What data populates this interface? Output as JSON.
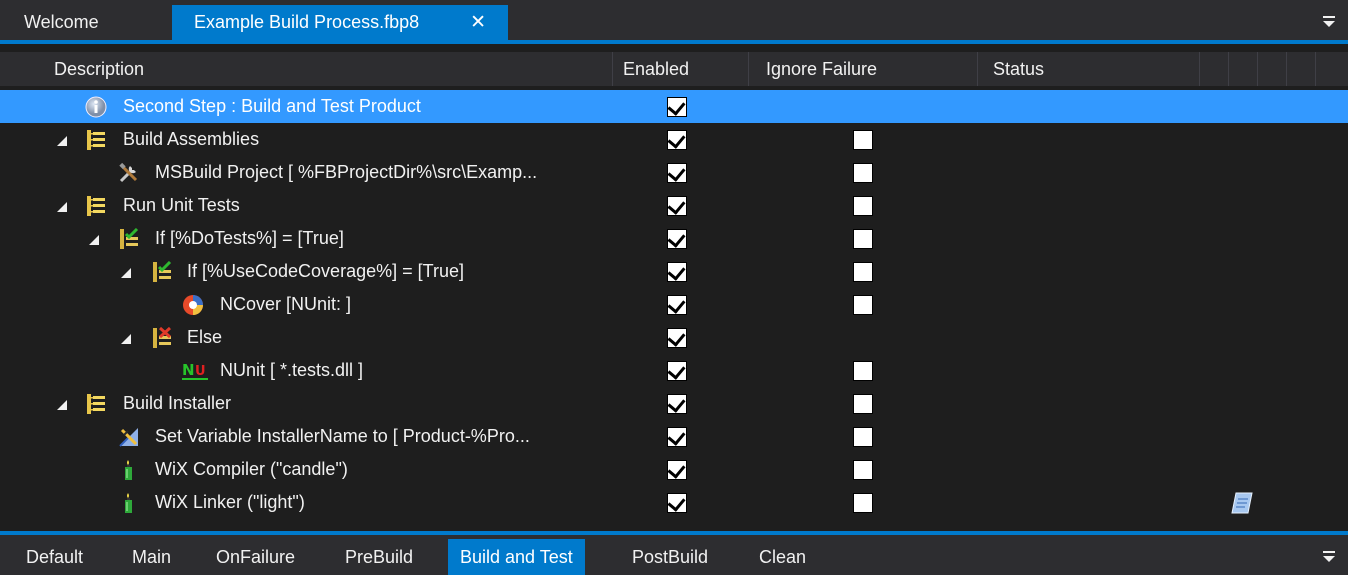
{
  "doc_tabs": {
    "welcome": "Welcome",
    "active": "Example Build Process.fbp8",
    "close_glyph": "✕"
  },
  "grid": {
    "columns": {
      "description": "Description",
      "enabled": "Enabled",
      "ignore_failure": "Ignore Failure",
      "status": "Status"
    },
    "rows": [
      {
        "label": "Second Step : Build and Test Product",
        "icon": "info-icon",
        "expanded": false,
        "enabled": true,
        "ignore_failure": null
      },
      {
        "label": "Build Assemblies",
        "icon": "group-icon",
        "expanded": true,
        "enabled": true,
        "ignore_failure": false
      },
      {
        "label": "MSBuild Project [ %FBProjectDir%\\src\\Examp...",
        "icon": "tools-icon",
        "expanded": false,
        "enabled": true,
        "ignore_failure": false
      },
      {
        "label": "Run Unit Tests",
        "icon": "group-icon",
        "expanded": true,
        "enabled": true,
        "ignore_failure": false
      },
      {
        "label": "If [%DoTests%] = [True]",
        "icon": "if-icon",
        "expanded": true,
        "enabled": true,
        "ignore_failure": false
      },
      {
        "label": "If [%UseCodeCoverage%] = [True]",
        "icon": "if-icon",
        "expanded": true,
        "enabled": true,
        "ignore_failure": false
      },
      {
        "label": "NCover [NUnit: ]",
        "icon": "ncover-icon",
        "expanded": false,
        "enabled": true,
        "ignore_failure": false
      },
      {
        "label": "Else",
        "icon": "else-icon",
        "expanded": true,
        "enabled": true,
        "ignore_failure": null
      },
      {
        "label": "NUnit [ *.tests.dll ]",
        "icon": "nunit-icon",
        "expanded": false,
        "enabled": true,
        "ignore_failure": false
      },
      {
        "label": "Build Installer",
        "icon": "group-icon",
        "expanded": true,
        "enabled": true,
        "ignore_failure": false
      },
      {
        "label": "Set Variable InstallerName to [ Product-%Pro...",
        "icon": "set-variable-icon",
        "expanded": false,
        "enabled": true,
        "ignore_failure": false
      },
      {
        "label": "WiX Compiler (\"candle\")",
        "icon": "candle-icon",
        "expanded": false,
        "enabled": true,
        "ignore_failure": false
      },
      {
        "label": "WiX Linker (\"light\")",
        "icon": "candle-icon",
        "expanded": false,
        "enabled": true,
        "ignore_failure": false
      }
    ],
    "nunit_icon_text": "NU"
  },
  "bottom_tabs": {
    "items": [
      "Default",
      "Main",
      "OnFailure",
      "PreBuild",
      "Build and Test",
      "PostBuild",
      "Clean"
    ],
    "active": "Build and Test"
  },
  "colors": {
    "accent": "#007acc",
    "selection": "#3399ff",
    "background": "#1e1e1e",
    "chrome": "#2d2d30"
  }
}
